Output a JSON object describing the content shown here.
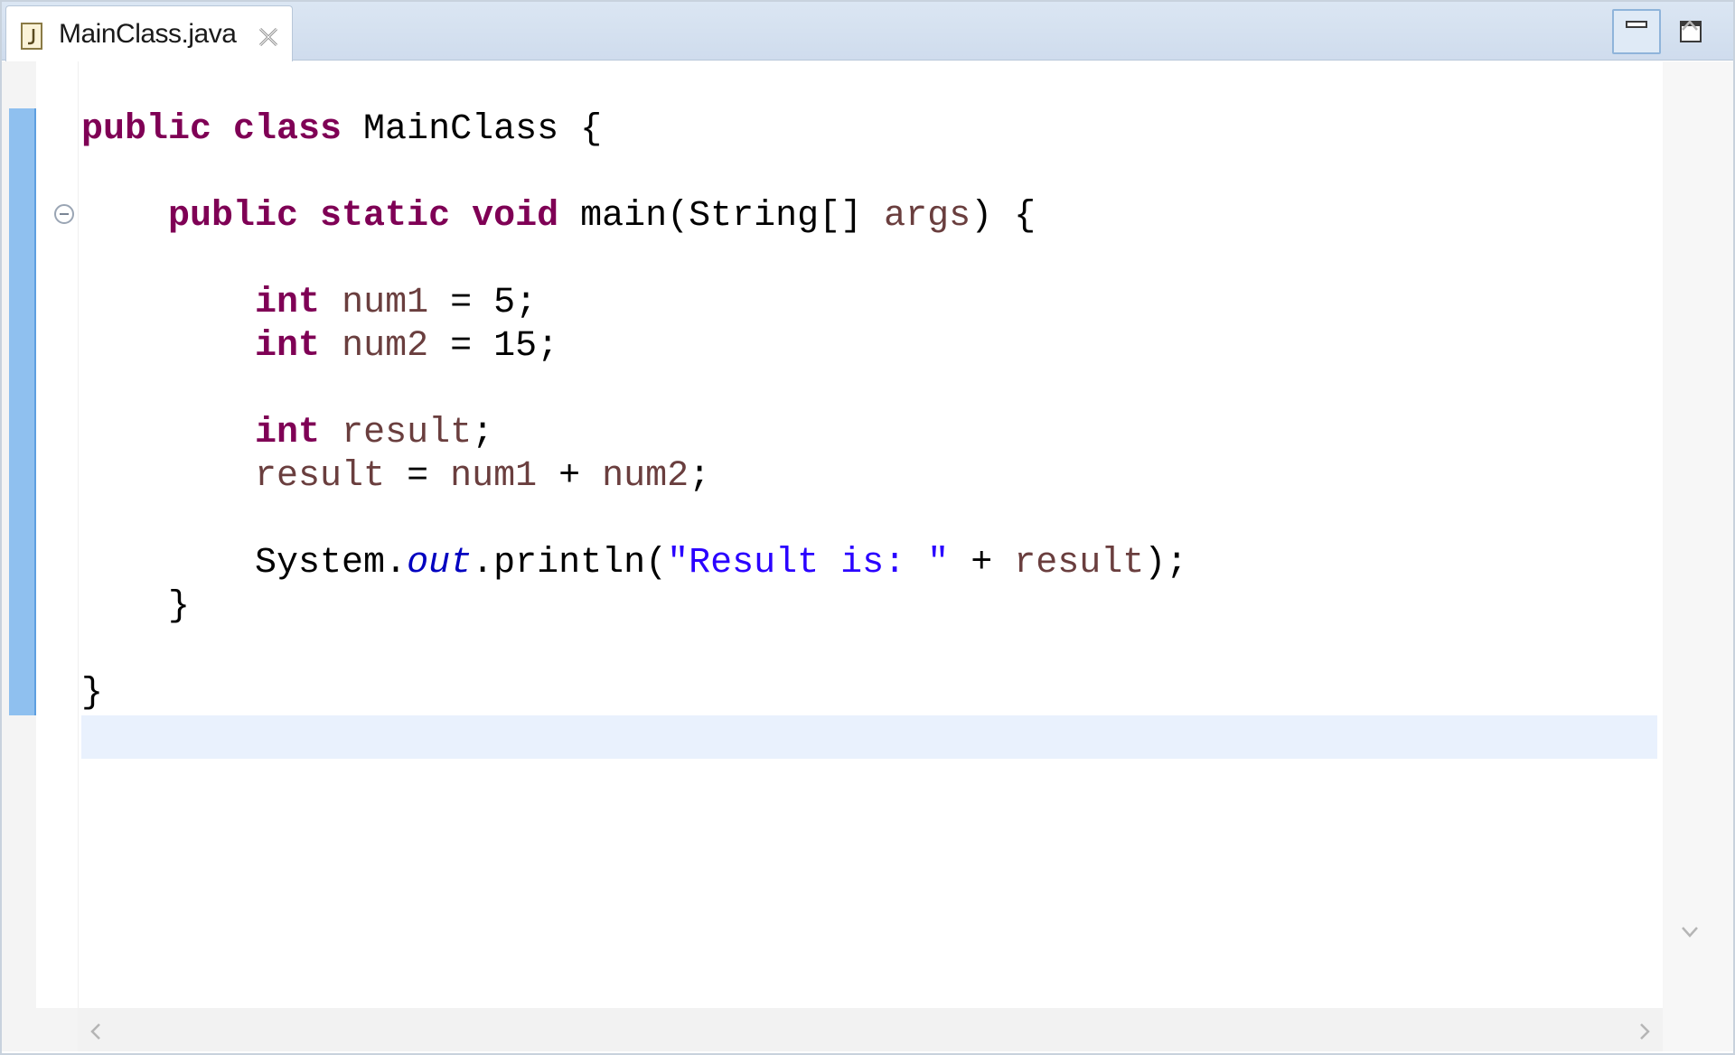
{
  "tab": {
    "title": "MainClass.java",
    "file_icon": "java-file-icon",
    "close_icon": "close-icon"
  },
  "window_controls": {
    "minimize_icon": "minimize-icon",
    "maximize_icon": "maximize-icon"
  },
  "code": {
    "lines": [
      [
        {
          "t": "public class",
          "c": "kw"
        },
        {
          "t": " MainClass {",
          "c": ""
        }
      ],
      [],
      [
        {
          "t": "    public static void",
          "c": "kw"
        },
        {
          "t": " main(String[] ",
          "c": ""
        },
        {
          "t": "args",
          "c": "var"
        },
        {
          "t": ") {",
          "c": ""
        }
      ],
      [],
      [
        {
          "t": "        int",
          "c": "kw"
        },
        {
          "t": " ",
          "c": ""
        },
        {
          "t": "num1",
          "c": "var"
        },
        {
          "t": " = 5;",
          "c": ""
        }
      ],
      [
        {
          "t": "        int",
          "c": "kw"
        },
        {
          "t": " ",
          "c": ""
        },
        {
          "t": "num2",
          "c": "var"
        },
        {
          "t": " = 15;",
          "c": ""
        }
      ],
      [],
      [
        {
          "t": "        int",
          "c": "kw"
        },
        {
          "t": " ",
          "c": ""
        },
        {
          "t": "result",
          "c": "var"
        },
        {
          "t": ";",
          "c": ""
        }
      ],
      [
        {
          "t": "        result",
          "c": "var"
        },
        {
          "t": " = ",
          "c": ""
        },
        {
          "t": "num1",
          "c": "var"
        },
        {
          "t": " + ",
          "c": ""
        },
        {
          "t": "num2",
          "c": "var"
        },
        {
          "t": ";",
          "c": ""
        }
      ],
      [],
      [
        {
          "t": "        System.",
          "c": ""
        },
        {
          "t": "out",
          "c": "fld"
        },
        {
          "t": ".println(",
          "c": ""
        },
        {
          "t": "\"Result is: \"",
          "c": "str"
        },
        {
          "t": " + ",
          "c": ""
        },
        {
          "t": "result",
          "c": "var"
        },
        {
          "t": ");",
          "c": ""
        }
      ],
      [
        {
          "t": "    }",
          "c": ""
        }
      ],
      [],
      [
        {
          "t": "}",
          "c": ""
        }
      ],
      []
    ]
  },
  "colors": {
    "keyword": "#7f0055",
    "local_variable": "#6a3e3e",
    "string": "#2a00ff",
    "static_field": "#0000c0",
    "current_line": "#e9f1fd",
    "change_bar": "#8fc0ef"
  },
  "scrollbars": {
    "up_icon": "chevron-up-icon",
    "down_icon": "chevron-down-icon",
    "left_icon": "chevron-left-icon",
    "right_icon": "chevron-right-icon"
  }
}
